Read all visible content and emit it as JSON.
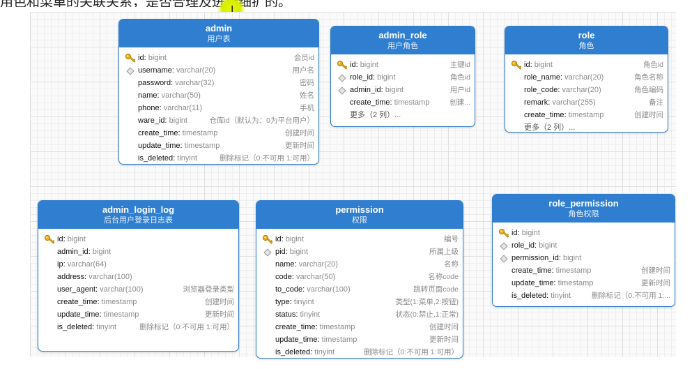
{
  "caption": "用色和菜单的关联关系，是否合理及进行细扩的。",
  "entities": [
    {
      "name": "admin",
      "comment": "用户表",
      "fields": [
        {
          "name": "id",
          "type": "bigint",
          "comment": "会员id",
          "icon": "key-icon"
        },
        {
          "name": "username",
          "type": "varchar(20)",
          "comment": "用户名",
          "icon": "index-icon"
        },
        {
          "name": "password",
          "type": "varchar(32)",
          "comment": "密码",
          "icon": ""
        },
        {
          "name": "name",
          "type": "varchar(50)",
          "comment": "姓名",
          "icon": ""
        },
        {
          "name": "phone",
          "type": "varchar(11)",
          "comment": "手机",
          "icon": ""
        },
        {
          "name": "ware_id",
          "type": "bigint",
          "comment": "仓库id（默认为：0为平台用户）",
          "icon": ""
        },
        {
          "name": "create_time",
          "type": "timestamp",
          "comment": "创建时间",
          "icon": ""
        },
        {
          "name": "update_time",
          "type": "timestamp",
          "comment": "更新时间",
          "icon": ""
        },
        {
          "name": "is_deleted",
          "type": "tinyint",
          "comment": "删除标记（0:不可用 1:可用）",
          "icon": ""
        }
      ]
    },
    {
      "name": "admin_role",
      "comment": "用户角色",
      "fields": [
        {
          "name": "id",
          "type": "bigint",
          "comment": "主键id",
          "icon": "key-icon"
        },
        {
          "name": "role_id",
          "type": "bigint",
          "comment": "角色id",
          "icon": "index-icon"
        },
        {
          "name": "admin_id",
          "type": "bigint",
          "comment": "用户id",
          "icon": "index-icon"
        },
        {
          "name": "create_time",
          "type": "timestamp",
          "comment": "创建...",
          "icon": ""
        }
      ],
      "more": "更多（2 列）..."
    },
    {
      "name": "role",
      "comment": "角色",
      "fields": [
        {
          "name": "id",
          "type": "bigint",
          "comment": "角色id",
          "icon": "key-icon"
        },
        {
          "name": "role_name",
          "type": "varchar(20)",
          "comment": "角色名称",
          "icon": ""
        },
        {
          "name": "role_code",
          "type": "varchar(20)",
          "comment": "角色编码",
          "icon": ""
        },
        {
          "name": "remark",
          "type": "varchar(255)",
          "comment": "备注",
          "icon": ""
        },
        {
          "name": "create_time",
          "type": "timestamp",
          "comment": "创建时间",
          "icon": ""
        }
      ],
      "more": "更多（2 列）..."
    },
    {
      "name": "admin_login_log",
      "comment": "后台用户登录日志表",
      "fields": [
        {
          "name": "id",
          "type": "bigint",
          "comment": "",
          "icon": "key-icon"
        },
        {
          "name": "admin_id",
          "type": "bigint",
          "comment": "",
          "icon": ""
        },
        {
          "name": "ip",
          "type": "varchar(64)",
          "comment": "",
          "icon": ""
        },
        {
          "name": "address",
          "type": "varchar(100)",
          "comment": "",
          "icon": ""
        },
        {
          "name": "user_agent",
          "type": "varchar(100)",
          "comment": "浏览器登录类型",
          "icon": ""
        },
        {
          "name": "create_time",
          "type": "timestamp",
          "comment": "创建时间",
          "icon": ""
        },
        {
          "name": "update_time",
          "type": "timestamp",
          "comment": "更新时间",
          "icon": ""
        },
        {
          "name": "is_deleted",
          "type": "tinyint",
          "comment": "删除标记（0:不可用 1:可用）",
          "icon": ""
        }
      ]
    },
    {
      "name": "permission",
      "comment": "权限",
      "fields": [
        {
          "name": "id",
          "type": "bigint",
          "comment": "编号",
          "icon": "key-icon"
        },
        {
          "name": "pid",
          "type": "bigint",
          "comment": "所属上级",
          "icon": "index-icon"
        },
        {
          "name": "name",
          "type": "varchar(20)",
          "comment": "名称",
          "icon": ""
        },
        {
          "name": "code",
          "type": "varchar(50)",
          "comment": "名称code",
          "icon": ""
        },
        {
          "name": "to_code",
          "type": "varchar(100)",
          "comment": "跳转页面code",
          "icon": ""
        },
        {
          "name": "type",
          "type": "tinyint",
          "comment": "类型(1:菜单,2:按钮)",
          "icon": ""
        },
        {
          "name": "status",
          "type": "tinyint",
          "comment": "状态(0:禁止,1:正常)",
          "icon": ""
        },
        {
          "name": "create_time",
          "type": "timestamp",
          "comment": "创建时间",
          "icon": ""
        },
        {
          "name": "update_time",
          "type": "timestamp",
          "comment": "更新时间",
          "icon": ""
        },
        {
          "name": "is_deleted",
          "type": "tinyint",
          "comment": "删除标记（0:不可用 1:可用）",
          "icon": ""
        }
      ]
    },
    {
      "name": "role_permission",
      "comment": "角色权限",
      "fields": [
        {
          "name": "id",
          "type": "bigint",
          "comment": "",
          "icon": "key-icon"
        },
        {
          "name": "role_id",
          "type": "bigint",
          "comment": "",
          "icon": "index-icon"
        },
        {
          "name": "permission_id",
          "type": "bigint",
          "comment": "",
          "icon": "index-icon"
        },
        {
          "name": "create_time",
          "type": "timestamp",
          "comment": "创建时间",
          "icon": ""
        },
        {
          "name": "update_time",
          "type": "timestamp",
          "comment": "更新时间",
          "icon": ""
        },
        {
          "name": "is_deleted",
          "type": "tinyint",
          "comment": "删除标记（0:不可用 1:...",
          "icon": ""
        }
      ]
    }
  ]
}
